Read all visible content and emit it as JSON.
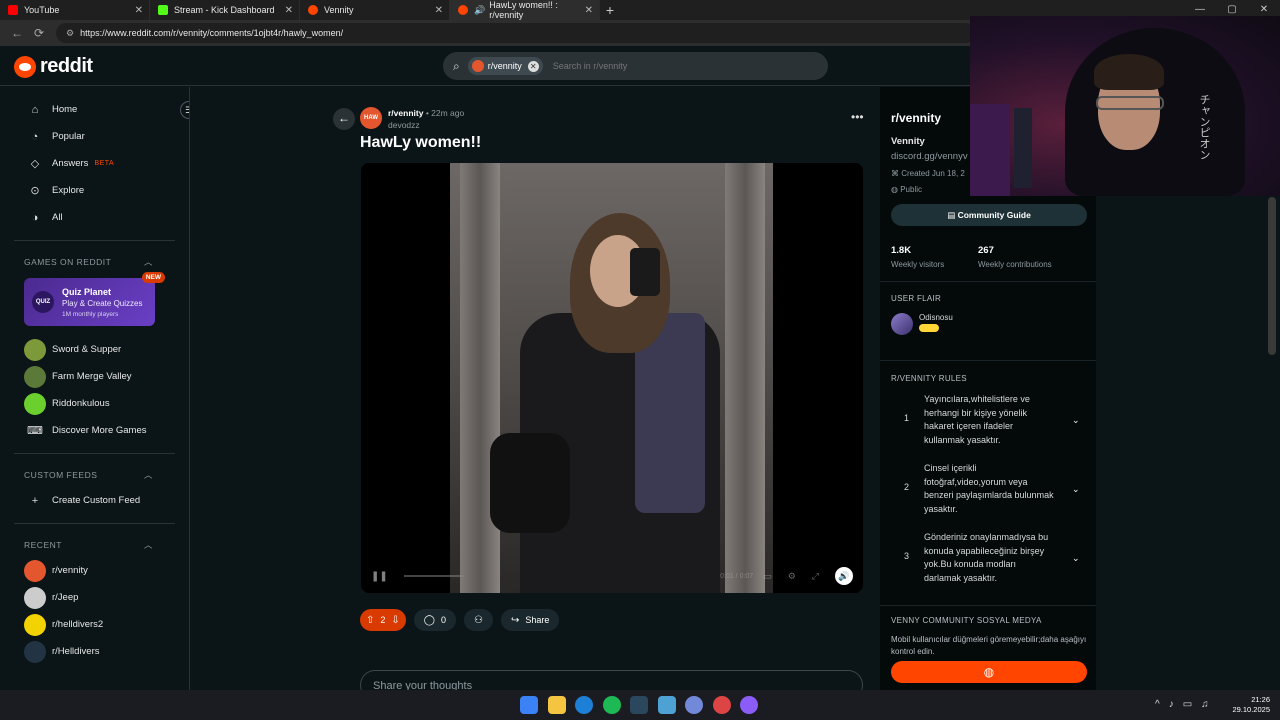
{
  "browser": {
    "tabs": [
      {
        "label": "YouTube",
        "color": "#ff0000",
        "active": false
      },
      {
        "label": "Stream - Kick Dashboard",
        "color": "#53fc18",
        "active": false
      },
      {
        "label": "Vennity",
        "color": "#ff4500",
        "active": false
      },
      {
        "label": "HawLy women!! : r/vennity",
        "color": "#ff4500",
        "active": true
      }
    ],
    "new_tab": "+",
    "url": "https://www.reddit.com/r/vennity/comments/1ojbt4r/hawly_women/"
  },
  "header": {
    "logo_text": "reddit",
    "search_chip": "r/vennity",
    "search_placeholder": "Search in r/vennity"
  },
  "sidebar": {
    "nav": [
      {
        "label": "Home",
        "icon": "home-icon",
        "glyph": "⌂"
      },
      {
        "label": "Popular",
        "icon": "popular-icon",
        "glyph": "◔"
      },
      {
        "label": "Answers",
        "icon": "answers-icon",
        "glyph": "◇",
        "badge": "BETA"
      },
      {
        "label": "Explore",
        "icon": "explore-icon",
        "glyph": "⊙"
      },
      {
        "label": "All",
        "icon": "all-icon",
        "glyph": "◑"
      }
    ],
    "games_header": "GAMES ON REDDIT",
    "quiz": {
      "logo": "QUIZ",
      "title": "Quiz Planet",
      "subtitle": "Play & Create Quizzes",
      "meta": "1M monthly players",
      "badge": "NEW"
    },
    "games": [
      {
        "label": "Sword & Supper",
        "color": "#7c9a3a"
      },
      {
        "label": "Farm Merge Valley",
        "color": "#5b7a3a"
      },
      {
        "label": "Riddonkulous",
        "color": "#6bcf2e"
      },
      {
        "label": "Discover More Games",
        "color": ""
      }
    ],
    "custom_header": "CUSTOM FEEDS",
    "create_feed": "Create Custom Feed",
    "recent_header": "RECENT",
    "recent": [
      {
        "label": "r/vennity",
        "color": "#e4572e"
      },
      {
        "label": "r/Jeep",
        "color": "#cccccc"
      },
      {
        "label": "r/helldivers2",
        "color": "#f2d200"
      },
      {
        "label": "r/Helldivers",
        "color": "#223344"
      }
    ]
  },
  "post": {
    "subreddit": "r/vennity",
    "age": "22m ago",
    "author": "devodzz",
    "title": "HawLy women!!",
    "time": "0:01 / 0:07",
    "votes": "2",
    "comments": "0",
    "share": "Share",
    "comment_placeholder": "Share your thoughts"
  },
  "community": {
    "title": "r/vennity",
    "name": "Vennity",
    "desc": "discord.gg/vennyv",
    "created": "Created Jun 18, 2",
    "visibility": "Public",
    "guide": "Community Guide",
    "visitors": "1.8K",
    "visitors_label": "Weekly visitors",
    "contribs": "267",
    "contribs_label": "Weekly contributions",
    "flair_header": "USER FLAIR",
    "flair_name": "Odisnosu",
    "rules_header": "R/VENNITY RULES",
    "rules": [
      {
        "n": "1",
        "text": "Yayıncılara,whitelistlere ve herhangi bir kişiye yönelik hakaret içeren ifadeler kullanmak yasaktır."
      },
      {
        "n": "2",
        "text": "Cinsel içerikli fotoğraf,video,yorum veya benzeri paylaşımlarda bulunmak yasaktır."
      },
      {
        "n": "3",
        "text": "Gönderiniz onaylanmadıysa bu konuda yapabileceğiniz birşey yok.Bu konuda modları darlamak yasaktır."
      }
    ],
    "social_header": "VENNY COMMUNITY SOSYAL MEDYA",
    "social_desc": "Mobil kullanıcılar düğmeleri göremeyebilir;daha aşağıyı kontrol edin."
  },
  "webcam": {
    "kana": "チャンピオン"
  },
  "taskbar": {
    "apps": [
      "#3b82f6",
      "#f5c542",
      "#1e7fd6",
      "#1db954",
      "#2a475e",
      "#4ea1d3",
      "#7289da",
      "#d44",
      "#8b5cf6"
    ],
    "time": "21:26",
    "date": "29.10.2025"
  }
}
